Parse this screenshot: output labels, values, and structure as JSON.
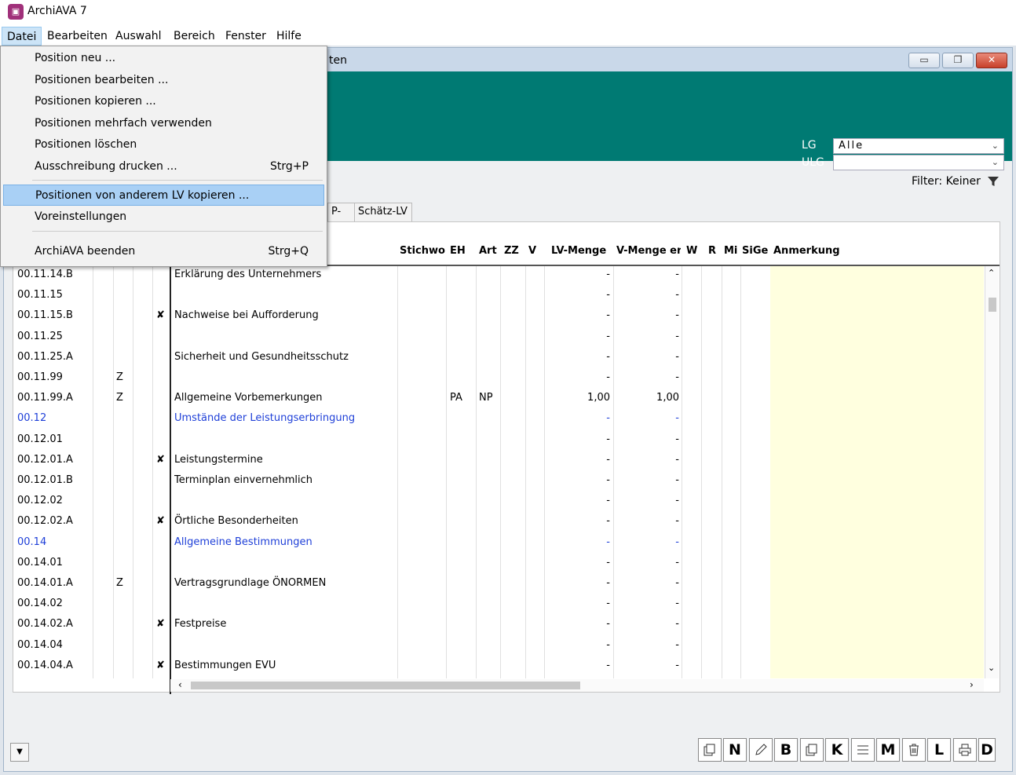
{
  "app": {
    "title": "ArchiAVA 7",
    "icon": "app-logo-icon"
  },
  "menubar": [
    "Datei",
    "Bearbeiten",
    "Auswahl",
    "Bereich",
    "Fenster",
    "Hilfe"
  ],
  "child_window": {
    "title_fragment": "ten",
    "minimize": "▭",
    "restore": "❐",
    "close": "✕"
  },
  "filters": {
    "lg_label": "LG",
    "lg_value": "Alle",
    "ulg_label": "ULG",
    "ulg_value": "",
    "filter_text": "Filter: Keiner",
    "filter_icon": "funnel-icon"
  },
  "tabs": [
    "P-EP",
    "Schätz-LV"
  ],
  "columns": [
    "Stichwo",
    "EH",
    "Art",
    "ZZ",
    "V",
    "LV-Menge",
    "V-Menge er",
    "W",
    "R",
    "Mi",
    "SiGe",
    "Anmerkung"
  ],
  "rows": [
    {
      "pos": "00.11.14.B",
      "z": "",
      "x": "",
      "desc": "Erklärung des Unternehmers",
      "eh": "",
      "art": "",
      "lvm": "-",
      "vm": "-",
      "blue": false
    },
    {
      "pos": "00.11.15",
      "z": "",
      "x": "",
      "desc": "",
      "eh": "",
      "art": "",
      "lvm": "-",
      "vm": "-",
      "blue": false
    },
    {
      "pos": "00.11.15.B",
      "z": "",
      "x": "✘",
      "desc": "Nachweise bei Aufforderung",
      "eh": "",
      "art": "",
      "lvm": "-",
      "vm": "-",
      "blue": false
    },
    {
      "pos": "00.11.25",
      "z": "",
      "x": "",
      "desc": "",
      "eh": "",
      "art": "",
      "lvm": "-",
      "vm": "-",
      "blue": false
    },
    {
      "pos": "00.11.25.A",
      "z": "",
      "x": "",
      "desc": "Sicherheit und Gesundheitsschutz",
      "eh": "",
      "art": "",
      "lvm": "-",
      "vm": "-",
      "blue": false
    },
    {
      "pos": "00.11.99",
      "z": "Z",
      "x": "",
      "desc": "",
      "eh": "",
      "art": "",
      "lvm": "-",
      "vm": "-",
      "blue": false
    },
    {
      "pos": "00.11.99.A",
      "z": "Z",
      "x": "",
      "desc": "Allgemeine Vorbemerkungen",
      "eh": "PA",
      "art": "NP",
      "lvm": "1,00",
      "vm": "1,00",
      "blue": false
    },
    {
      "pos": "00.12",
      "z": "",
      "x": "",
      "desc": "Umstände der Leistungserbringung",
      "eh": "",
      "art": "",
      "lvm": "-",
      "vm": "-",
      "blue": true
    },
    {
      "pos": "00.12.01",
      "z": "",
      "x": "",
      "desc": "",
      "eh": "",
      "art": "",
      "lvm": "-",
      "vm": "-",
      "blue": false
    },
    {
      "pos": "00.12.01.A",
      "z": "",
      "x": "✘",
      "desc": "Leistungstermine",
      "eh": "",
      "art": "",
      "lvm": "-",
      "vm": "-",
      "blue": false
    },
    {
      "pos": "00.12.01.B",
      "z": "",
      "x": "",
      "desc": "Terminplan einvernehmlich",
      "eh": "",
      "art": "",
      "lvm": "-",
      "vm": "-",
      "blue": false
    },
    {
      "pos": "00.12.02",
      "z": "",
      "x": "",
      "desc": "",
      "eh": "",
      "art": "",
      "lvm": "-",
      "vm": "-",
      "blue": false
    },
    {
      "pos": "00.12.02.A",
      "z": "",
      "x": "✘",
      "desc": "Örtliche Besonderheiten",
      "eh": "",
      "art": "",
      "lvm": "-",
      "vm": "-",
      "blue": false
    },
    {
      "pos": "00.14",
      "z": "",
      "x": "",
      "desc": "Allgemeine Bestimmungen",
      "eh": "",
      "art": "",
      "lvm": "-",
      "vm": "-",
      "blue": true
    },
    {
      "pos": "00.14.01",
      "z": "",
      "x": "",
      "desc": "",
      "eh": "",
      "art": "",
      "lvm": "-",
      "vm": "-",
      "blue": false
    },
    {
      "pos": "00.14.01.A",
      "z": "Z",
      "x": "",
      "desc": "Vertragsgrundlage ÖNORMEN",
      "eh": "",
      "art": "",
      "lvm": "-",
      "vm": "-",
      "blue": false
    },
    {
      "pos": "00.14.02",
      "z": "",
      "x": "",
      "desc": "",
      "eh": "",
      "art": "",
      "lvm": "-",
      "vm": "-",
      "blue": false
    },
    {
      "pos": "00.14.02.A",
      "z": "",
      "x": "✘",
      "desc": "Festpreise",
      "eh": "",
      "art": "",
      "lvm": "-",
      "vm": "-",
      "blue": false
    },
    {
      "pos": "00.14.04",
      "z": "",
      "x": "",
      "desc": "",
      "eh": "",
      "art": "",
      "lvm": "-",
      "vm": "-",
      "blue": false
    },
    {
      "pos": "00.14.04.A",
      "z": "",
      "x": "✘",
      "desc": "Bestimmungen EVU",
      "eh": "",
      "art": "",
      "lvm": "-",
      "vm": "-",
      "blue": false
    }
  ],
  "dropdown": [
    {
      "label": "Position neu ...",
      "shortcut": ""
    },
    {
      "label": "Positionen bearbeiten ...",
      "shortcut": ""
    },
    {
      "label": "Positionen kopieren ...",
      "shortcut": ""
    },
    {
      "label": "Positionen mehrfach verwenden",
      "shortcut": ""
    },
    {
      "label": "Positionen löschen",
      "shortcut": ""
    },
    {
      "label": "Ausschreibung drucken ...",
      "shortcut": "Strg+P"
    },
    {
      "label": "Positionen von anderem LV kopieren ...",
      "shortcut": ""
    },
    {
      "label": "Voreinstellungen",
      "shortcut": ""
    },
    {
      "label": "ArchiAVA beenden",
      "shortcut": "Strg+Q"
    }
  ],
  "toolbar": [
    {
      "icon": "new-position-icon",
      "key": "N"
    },
    {
      "icon": "pencil-edit-icon",
      "key": "B"
    },
    {
      "icon": "copy-icon",
      "key": "K"
    },
    {
      "icon": "multi-use-list-icon",
      "key": "M"
    },
    {
      "icon": "trash-icon",
      "key": "L"
    },
    {
      "icon": "printer-icon",
      "key": "D"
    }
  ]
}
